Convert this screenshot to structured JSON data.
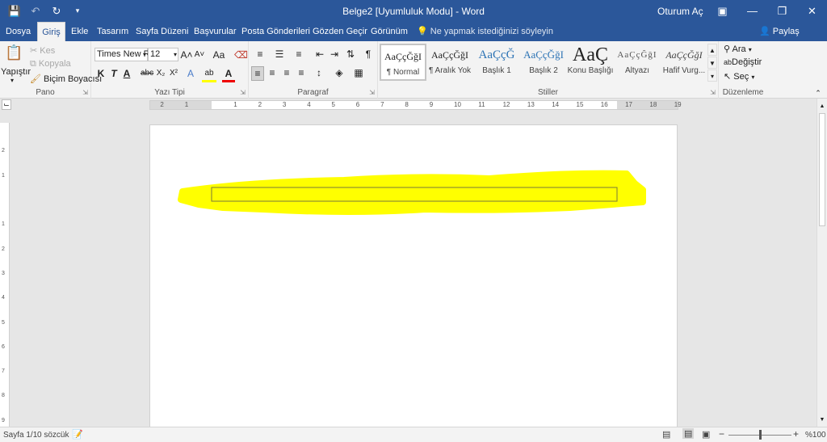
{
  "title_bar": {
    "title": "Belge2 [Uyumluluk Modu]  -  Word",
    "sign_in": "Oturum Aç",
    "bg": "#2b579a"
  },
  "tabs": {
    "file": "Dosya",
    "home": "Giriş",
    "insert": "Ekle",
    "design": "Tasarım",
    "layout": "Sayfa Düzeni",
    "references": "Başvurular",
    "mailings": "Posta Gönderileri",
    "review": "Gözden Geçir",
    "view": "Görünüm",
    "tell_me": "Ne yapmak istediğinizi söyleyin",
    "share": "Paylaş"
  },
  "clipboard": {
    "paste": "Yapıştır",
    "cut": "Kes",
    "copy": "Kopyala",
    "format_painter": "Biçim Boyacısı",
    "label": "Pano"
  },
  "font": {
    "name": "Times New R",
    "size": "12",
    "bold": "K",
    "italic": "T",
    "underline": "A",
    "strike": "abc",
    "sub": "X₂",
    "sup": "X²",
    "grow": "A˄",
    "shrink": "A˅",
    "case": "Aa",
    "label": "Yazı Tipi"
  },
  "paragraph": {
    "label": "Paragraf",
    "pilcrow": "¶"
  },
  "styles": {
    "label": "Stiller",
    "items": [
      {
        "preview": "AaÇçĞğI",
        "name": "¶ Normal"
      },
      {
        "preview": "AaÇçĞğI",
        "name": "¶ Aralık Yok"
      },
      {
        "preview": "AaÇçĞ",
        "name": "Başlık 1"
      },
      {
        "preview": "AaÇçĞğI",
        "name": "Başlık 2"
      },
      {
        "preview": "AaÇ",
        "name": "Konu Başlığı"
      },
      {
        "preview": "AaÇçĞğI",
        "name": "Altyazı"
      },
      {
        "preview": "AaÇçĞğI",
        "name": "Hafif Vurg..."
      }
    ]
  },
  "editing": {
    "find": "Ara",
    "replace": "Değiştir",
    "select": "Seç",
    "label": "Düzenleme"
  },
  "ruler": {
    "h_ticks": [
      "2",
      "1",
      "1",
      "2",
      "3",
      "4",
      "5",
      "6",
      "7",
      "8",
      "9",
      "10",
      "11",
      "12",
      "13",
      "14",
      "15",
      "16",
      "17",
      "18",
      "19"
    ],
    "v_ticks": [
      "2",
      "1",
      "1",
      "2",
      "3",
      "4",
      "5",
      "6",
      "7",
      "8",
      "9"
    ]
  },
  "document": {
    "text_box_content": "",
    "highlight_color": "#ffff00"
  },
  "status": {
    "page": "Sayfa 1/1",
    "words": "0 sözcük",
    "zoom": "%100"
  }
}
